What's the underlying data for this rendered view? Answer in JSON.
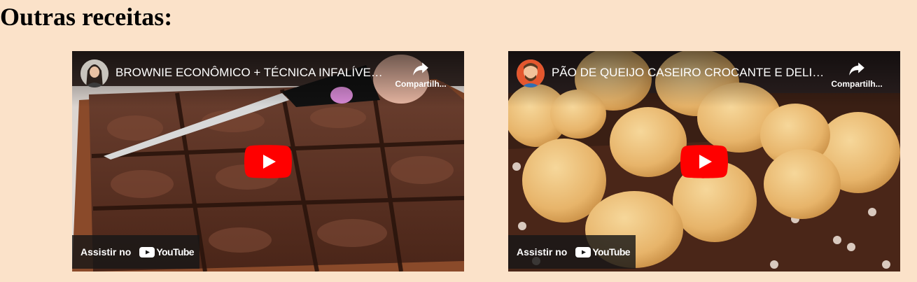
{
  "page": {
    "section_title": "Outras receitas:"
  },
  "videos": [
    {
      "title": "BROWNIE ECONÔMICO + TÉCNICA INFALÍVEL PARA CASQUINHA",
      "share_label": "Compartilh...",
      "watch_on_label": "Assistir no",
      "brand": "YouTube",
      "avatar_icon": "channel-avatar-woman",
      "thumbnail_subject": "brownie-thumbnail"
    },
    {
      "title": "PÃO DE QUEIJO CASEIRO CROCANTE E DELICIOSO",
      "share_label": "Compartilh...",
      "watch_on_label": "Assistir no",
      "brand": "YouTube",
      "avatar_icon": "channel-avatar-chef",
      "thumbnail_subject": "pao-de-queijo-thumbnail"
    }
  ],
  "colors": {
    "page_background": "#fbe2c9",
    "youtube_red": "#ff0000",
    "overlay_dark": "#171717"
  }
}
